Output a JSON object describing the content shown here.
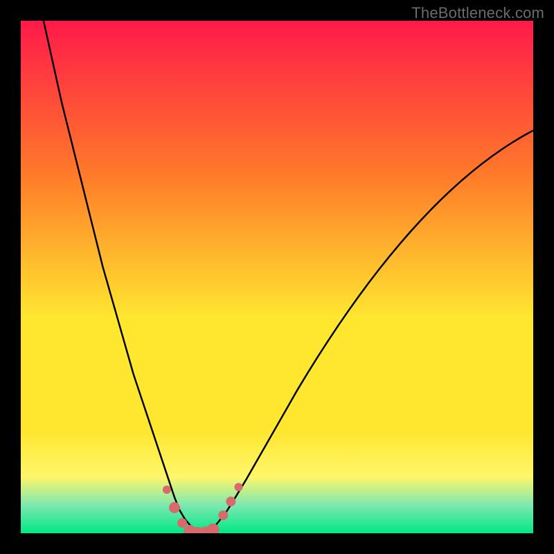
{
  "watermark": "TheBottleneck.com",
  "colors": {
    "gradient_top": "#ff1a4a",
    "gradient_mid1": "#ff7a2a",
    "gradient_mid2": "#ffe730",
    "gradient_yellow_pale": "#fff66a",
    "gradient_mint": "#7de8b0",
    "gradient_bottom": "#00e884",
    "curve": "#000000",
    "marker_fill": "#d76a6a",
    "marker_stroke": "#b85454"
  },
  "chart_data": {
    "type": "line",
    "title": "",
    "xlabel": "",
    "ylabel": "",
    "xlim": [
      0,
      100
    ],
    "ylim": [
      0,
      100
    ],
    "x": [
      0,
      2,
      4,
      6,
      8,
      10,
      12,
      14,
      16,
      18,
      20,
      22,
      24,
      25,
      26,
      27,
      28,
      29,
      30,
      31,
      32,
      33,
      34,
      35,
      36,
      37,
      38,
      40,
      42,
      44,
      46,
      48,
      50,
      52,
      54,
      56,
      58,
      60,
      62,
      64,
      66,
      68,
      70,
      72,
      74,
      76,
      78,
      80,
      82,
      84,
      86,
      88,
      90,
      92,
      94,
      96,
      98,
      100
    ],
    "y": [
      120,
      111,
      102,
      93,
      84,
      76,
      68,
      60,
      52,
      45,
      38,
      31,
      25,
      22,
      19,
      16,
      13,
      10,
      7,
      4.5,
      2.8,
      1.6,
      0.8,
      0.2,
      0.1,
      0.5,
      1.5,
      4.0,
      7.2,
      10.5,
      14.0,
      17.5,
      21.0,
      24.5,
      28.0,
      31.3,
      34.5,
      37.6,
      40.6,
      43.5,
      46.3,
      49.0,
      51.6,
      54.1,
      56.5,
      58.8,
      61.0,
      63.1,
      65.1,
      67.0,
      68.8,
      70.5,
      72.1,
      73.6,
      75.0,
      76.3,
      77.5,
      78.6
    ],
    "markers": [
      {
        "x": 28.5,
        "y": 8.5,
        "r": 6
      },
      {
        "x": 30.0,
        "y": 5.0,
        "r": 8
      },
      {
        "x": 31.5,
        "y": 2.0,
        "r": 7
      },
      {
        "x": 33.0,
        "y": 0.4,
        "r": 9
      },
      {
        "x": 34.5,
        "y": 0.0,
        "r": 9
      },
      {
        "x": 36.0,
        "y": 0.1,
        "r": 9
      },
      {
        "x": 37.5,
        "y": 0.7,
        "r": 9
      },
      {
        "x": 39.5,
        "y": 3.5,
        "r": 7
      },
      {
        "x": 41.0,
        "y": 6.2,
        "r": 7
      },
      {
        "x": 42.5,
        "y": 9.0,
        "r": 6
      }
    ],
    "gradient_stops": [
      {
        "offset": 0.0,
        "key": "gradient_top"
      },
      {
        "offset": 0.3,
        "key": "gradient_mid1"
      },
      {
        "offset": 0.58,
        "key": "gradient_mid2"
      },
      {
        "offset": 0.8,
        "key": "gradient_mid2"
      },
      {
        "offset": 0.89,
        "key": "gradient_yellow_pale"
      },
      {
        "offset": 0.945,
        "key": "gradient_mint"
      },
      {
        "offset": 1.0,
        "key": "gradient_bottom"
      }
    ]
  }
}
